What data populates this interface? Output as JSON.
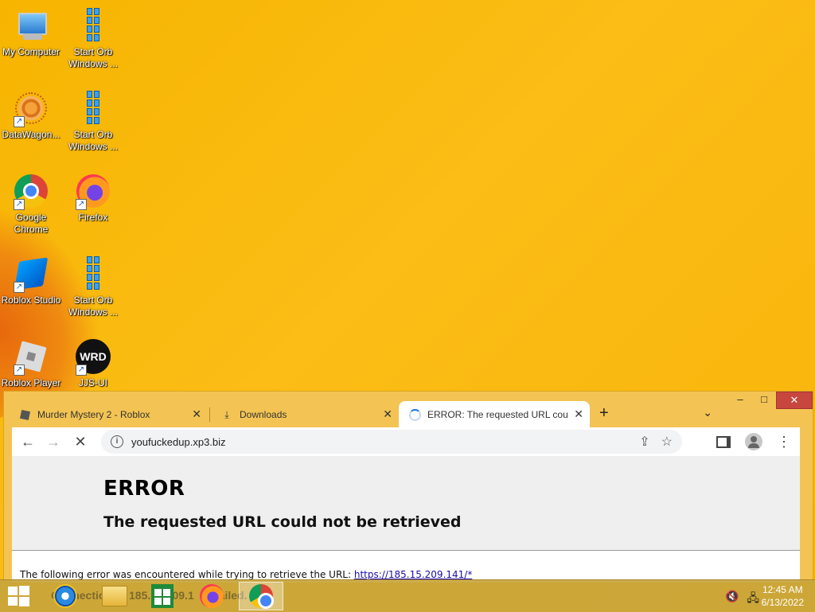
{
  "desktop": {
    "icons": [
      {
        "label": "My Computer",
        "icon": "computer-icon"
      },
      {
        "label": "Start Orb Windows ...",
        "icon": "windows-logo-icon"
      },
      {
        "label": "DataWagon...",
        "icon": "datawagon-icon"
      },
      {
        "label": "Start Orb Windows ...",
        "icon": "windows-logo-icon"
      },
      {
        "label": "Google Chrome",
        "icon": "chrome-icon"
      },
      {
        "label": "Firefox",
        "icon": "firefox-icon"
      },
      {
        "label": "Roblox Studio",
        "icon": "roblox-studio-icon"
      },
      {
        "label": "Start Orb Windows ...",
        "icon": "windows-logo-icon"
      },
      {
        "label": "Roblox Player",
        "icon": "roblox-player-icon"
      },
      {
        "label": "JJS-UI",
        "icon": "jjs-ui-icon"
      }
    ],
    "jjs_logo_text": "WRD"
  },
  "browser": {
    "tabs": [
      {
        "title": "Murder Mystery 2 - Roblox",
        "icon": "roblox-favicon"
      },
      {
        "title": "Downloads",
        "icon": "download-icon"
      },
      {
        "title": "ERROR: The requested URL could",
        "icon": "loading-spinner-icon"
      }
    ],
    "address": "youfuckedup.xp3.biz",
    "window_controls": {
      "minimize": "–",
      "maximize": "□",
      "close": "✕"
    }
  },
  "page": {
    "error_title": "ERROR",
    "error_subtitle": "The requested URL could not be retrieved",
    "error_line_prefix": "The following error was encountered while trying to retrieve the URL: ",
    "error_url": "https://185.15.209.141/*"
  },
  "taskbar": {
    "ghost_text_1": "Connection",
    "ghost_text_2": "185.15.209.1",
    "ghost_text_3": "failed.",
    "clock_time": "12:45 AM",
    "clock_date": "6/13/2022"
  },
  "colors": {
    "wallpaper": "#f9b70a",
    "close_button": "#c7463d",
    "link": "#1a0dab"
  }
}
